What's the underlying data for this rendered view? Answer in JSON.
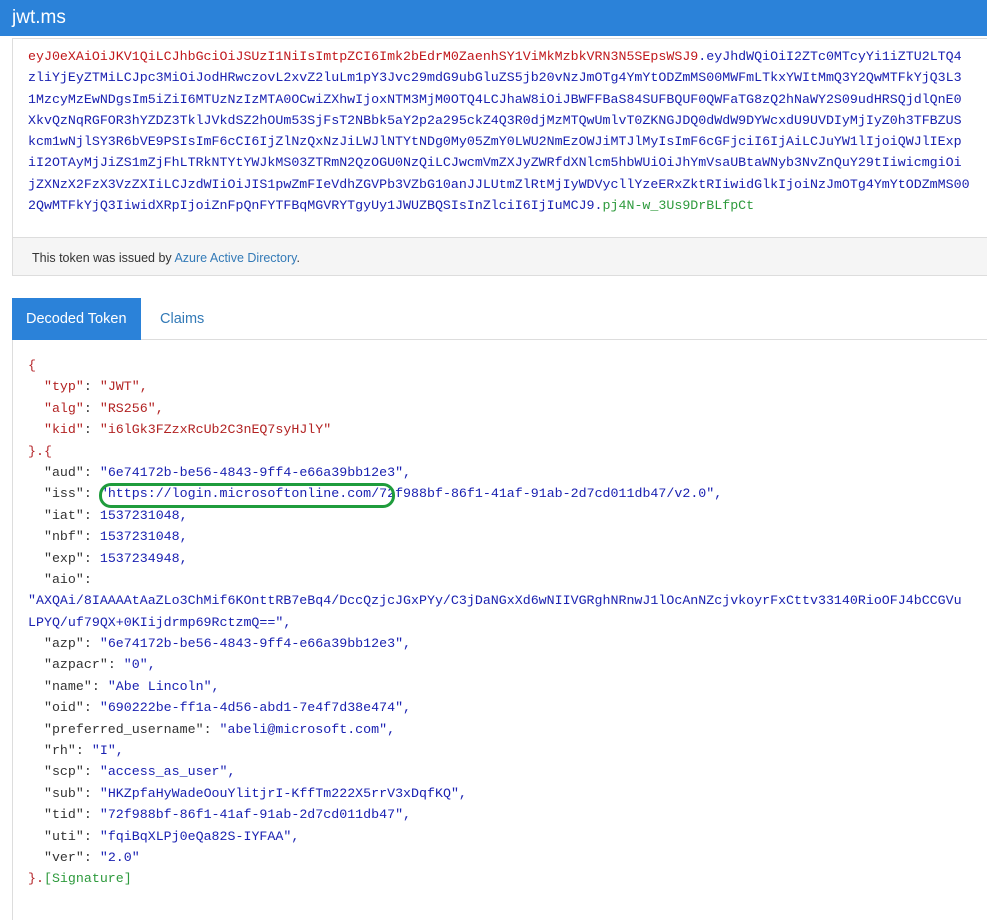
{
  "app": {
    "title": "jwt.ms"
  },
  "encoded_token": {
    "lines": [
      [
        {
          "seg": "header",
          "text": "eyJ0eXAiOiJKV1QiLCJhbGciOiJSUzI1NiIsImtpZCI6Imk2bEdrM0ZaenhSY1ViMkMzbkVRN3N5SEpsWSJ9"
        },
        {
          "seg": "sep",
          "text": "."
        },
        {
          "seg": "payload",
          "text": "eyJhdWQiOiI2ZTc0MTcyYi1iZTU2LTQ4"
        }
      ],
      [
        {
          "seg": "payload",
          "text": "zliYjEyZTMiLCJpc3MiOiJodHRwczovL2xvZ2luLm1pY3Jvc29mdG9ubGluZS5jb20vNzJmOTg4YmYtODZmMS00MWFmLTkxYWItMmQ3Y2QwMTFkYjQ3L3"
        }
      ],
      [
        {
          "seg": "payload",
          "text": "1MzcyMzEwNDgsIm5iZiI6MTUzNzIzMTA0OCwiZXhwIjoxNTM3MjM0OTQ4LCJhaW8iOiJBWFFBaS84SUFBQUF0QWFaTG8zQ2hNaWY2S09udHRSQjdlQnE0"
        }
      ],
      [
        {
          "seg": "payload",
          "text": "XkvQzNqRGFOR3hYZDZ3TklJVkdSZ2hOUm53SjFsT2NBbk5aY2p2a295ckZ4Q3R0djMzMTQwUmlvT0ZKNGJDQ0dWdW9DYWcxdU9UVDIyMjIyZ0h3TFBZUS"
        }
      ],
      [
        {
          "seg": "payload",
          "text": "kcm1wNjlSY3R6bVE9PSIsImF6cCI6IjZlNzQxNzJiLWJlNTYtNDg0My05ZmY0LWU2NmEzOWJiMTJlMyIsImF6cGFjciI6IjAiLCJuYW1lIjoiQWJlIExp"
        }
      ],
      [
        {
          "seg": "payload",
          "text": "iI2OTAyMjJiZS1mZjFhLTRkNTYtYWJkMS03ZTRmN2QzOGU0NzQiLCJwcmVmZXJyZWRfdXNlcm5hbWUiOiJhYmVsaUBtaWNyb3NvZnQuY29tIiwicmgiOi"
        }
      ],
      [
        {
          "seg": "payload",
          "text": "jZXNzX2FzX3VzZXIiLCJzdWIiOiJIS1pwZmFIeVdhZGVPb3VZbG10anJJLUtmZlRtMjIyWDVycllYzeERxZktRIiwidGlkIjoiNzJmOTg4YmYtODZmMS00"
        }
      ],
      [
        {
          "seg": "payload",
          "text": "2QwMTFkYjQ3IiwidXRpIjoiZnFpQnFYTFBqMGVRYTgyUy1JWUZBQSIsInZlciI6IjIuMCJ9"
        },
        {
          "seg": "sep",
          "text": "."
        },
        {
          "seg": "sig",
          "text": "pj4N-w_3Us9DrBLfpCt"
        }
      ]
    ]
  },
  "issuer": {
    "prefix": "This token was issued by ",
    "link": "Azure Active Directory",
    "suffix": "."
  },
  "tabs": [
    {
      "label": "Decoded Token"
    },
    {
      "label": "Claims"
    }
  ],
  "decoded": {
    "header": [
      {
        "key": "typ",
        "value": "JWT"
      },
      {
        "key": "alg",
        "value": "RS256"
      },
      {
        "key": "kid",
        "value": "i6lGk3FZzxRcUb2C3nEQ7syHJlY"
      }
    ],
    "payload": [
      {
        "key": "aud",
        "value": "\"6e74172b-be56-4843-9ff4-e66a39bb12e3\","
      },
      {
        "key": "iss",
        "value": "\"https://login.microsoftonline.com/72f988bf-86f1-41af-91ab-2d7cd011db47/v2.0\","
      },
      {
        "key": "iat",
        "value": "1537231048,"
      },
      {
        "key": "nbf",
        "value": "1537231048,"
      },
      {
        "key": "exp",
        "value": "1537234948,"
      },
      {
        "key": "aio",
        "value": ""
      },
      {
        "key": "",
        "value": "\"AXQAi/8IAAAAtAaZLo3ChMif6KOnttRB7eBq4/DccQzjcJGxPYy/C3jDaNGxXd6wNIIVGRghNRnwJ1lOcAnNZcjvkoyrFxCttv33140RioOFJ4bCCGVu"
      },
      {
        "key": "",
        "value": "LPYQ/uf79QX+0KIijdrmp69RctzmQ==\","
      },
      {
        "key": "azp",
        "value": "\"6e74172b-be56-4843-9ff4-e66a39bb12e3\","
      },
      {
        "key": "azpacr",
        "value": "\"0\","
      },
      {
        "key": "name",
        "value": "\"Abe Lincoln\","
      },
      {
        "key": "oid",
        "value": "\"690222be-ff1a-4d56-abd1-7e4f7d38e474\","
      },
      {
        "key": "preferred_username",
        "value": "\"abeli@microsoft.com\","
      },
      {
        "key": "rh",
        "value": "\"I\","
      },
      {
        "key": "scp",
        "value": "\"access_as_user\","
      },
      {
        "key": "sub",
        "value": "\"HKZpfaHyWadeOouYlitjrI-KffTm222X5rrV3xDqfKQ\","
      },
      {
        "key": "tid",
        "value": "\"72f988bf-86f1-41af-91ab-2d7cd011db47\","
      },
      {
        "key": "uti",
        "value": "\"fqiBqXLPj0eQa82S-IYFAA\","
      },
      {
        "key": "ver",
        "value": "\"2.0\""
      }
    ],
    "open_brace": "{",
    "header_close": "}.{",
    "payload_close": "}.",
    "signature_label": "[Signature]"
  },
  "colors": {
    "navbar": "#2b82d9",
    "header_segment": "#c0171b",
    "payload_segment": "#1a21b1",
    "signature_segment": "#2d9a3c",
    "highlight_outline": "#1f9c3c"
  },
  "icons": []
}
